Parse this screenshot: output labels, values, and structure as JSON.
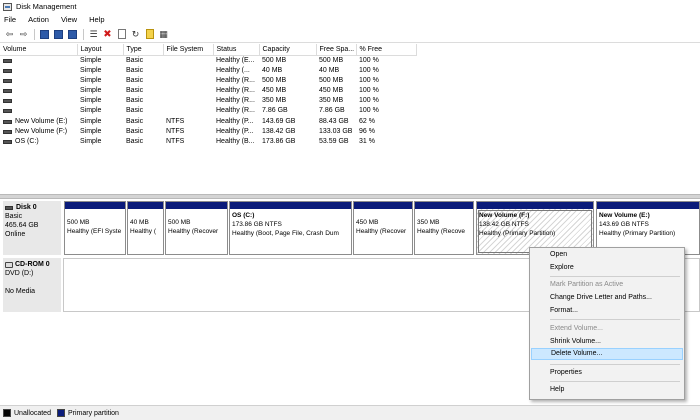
{
  "window": {
    "title": "Disk Management"
  },
  "menu": [
    "File",
    "Action",
    "View",
    "Help"
  ],
  "toolbar": {
    "icons": [
      "back-icon",
      "forward-icon",
      "show-hide-console-tree-icon",
      "help-icon",
      "properties-icon",
      "connect-icon",
      "delete-icon",
      "check-icon",
      "refresh-icon",
      "export-icon",
      "view-icon"
    ]
  },
  "table": {
    "columns": [
      "Volume",
      "Layout",
      "Type",
      "File System",
      "Status",
      "Capacity",
      "Free Spa...",
      "% Free"
    ],
    "rows": [
      [
        "",
        "Simple",
        "Basic",
        "",
        "Healthy (E...",
        "500 MB",
        "500 MB",
        "100 %"
      ],
      [
        "",
        "Simple",
        "Basic",
        "",
        "Healthy (...",
        "40 MB",
        "40 MB",
        "100 %"
      ],
      [
        "",
        "Simple",
        "Basic",
        "",
        "Healthy (R...",
        "500 MB",
        "500 MB",
        "100 %"
      ],
      [
        "",
        "Simple",
        "Basic",
        "",
        "Healthy (R...",
        "450 MB",
        "450 MB",
        "100 %"
      ],
      [
        "",
        "Simple",
        "Basic",
        "",
        "Healthy (R...",
        "350 MB",
        "350 MB",
        "100 %"
      ],
      [
        "",
        "Simple",
        "Basic",
        "",
        "Healthy (R...",
        "7.86 GB",
        "7.86 GB",
        "100 %"
      ],
      [
        "New Volume (E:)",
        "Simple",
        "Basic",
        "NTFS",
        "Healthy (P...",
        "143.69 GB",
        "88.43 GB",
        "62 %"
      ],
      [
        "New Volume (F:)",
        "Simple",
        "Basic",
        "NTFS",
        "Healthy (P...",
        "138.42 GB",
        "133.03 GB",
        "96 %"
      ],
      [
        "OS (C:)",
        "Simple",
        "Basic",
        "NTFS",
        "Healthy (B...",
        "173.86 GB",
        "53.59 GB",
        "31 %"
      ]
    ]
  },
  "disk0": {
    "name": "Disk 0",
    "type": "Basic",
    "size": "465.64 GB",
    "status": "Online",
    "partitions": [
      {
        "name": "",
        "size": "500 MB",
        "status": "Healthy (EFI Syste"
      },
      {
        "name": "",
        "size": "40 MB",
        "status": "Healthy ("
      },
      {
        "name": "",
        "size": "500 MB",
        "status": "Healthy (Recover"
      },
      {
        "name": "OS  (C:)",
        "size": "173.86 GB NTFS",
        "status": "Healthy (Boot, Page File, Crash Dum"
      },
      {
        "name": "",
        "size": "450 MB",
        "status": "Healthy (Recover"
      },
      {
        "name": "",
        "size": "350 MB",
        "status": "Healthy (Recove"
      },
      {
        "name": "New Volume  (F:)",
        "size": "138.42 GB NTFS",
        "status": "Healthy (Primary Partition)"
      },
      {
        "name": "New Volume  (E:)",
        "size": "143.69 GB NTFS",
        "status": "Healthy (Primary Partition)"
      }
    ]
  },
  "cdrom0": {
    "name": "CD-ROM 0",
    "type": "DVD (D:)",
    "status": "No Media"
  },
  "context_menu": {
    "items": [
      {
        "label": "Open",
        "enabled": true
      },
      {
        "label": "Explore",
        "enabled": true
      },
      {
        "label": "Mark Partition as Active",
        "enabled": false
      },
      {
        "label": "Change Drive Letter and Paths...",
        "enabled": true
      },
      {
        "label": "Format...",
        "enabled": true
      },
      {
        "label": "Extend Volume...",
        "enabled": false
      },
      {
        "label": "Shrink Volume...",
        "enabled": true
      },
      {
        "label": "Delete Volume...",
        "enabled": true,
        "highlighted": true
      },
      {
        "label": "Properties",
        "enabled": true
      },
      {
        "label": "Help",
        "enabled": true
      }
    ]
  },
  "legend": {
    "unallocated": "Unallocated",
    "primary": "Primary partition"
  },
  "colors": {
    "partition_bar": "#0a1b7a",
    "highlight": "#cce8ff"
  }
}
